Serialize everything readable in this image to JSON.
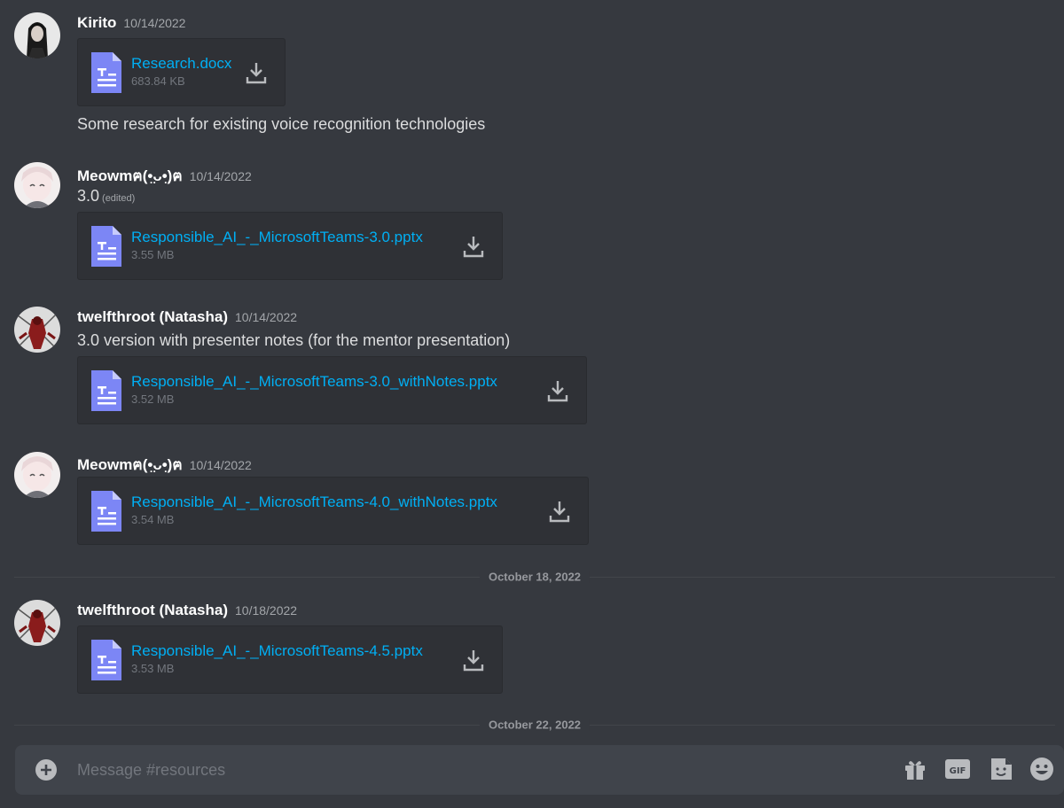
{
  "messages": [
    {
      "username": "Kirito",
      "timestamp": "10/14/2022",
      "file": {
        "name": "Research.docx",
        "size": "683.84 KB"
      },
      "text": "Some research for existing voice recognition technologies"
    },
    {
      "username": "Meowmฅ(•̤ᴗ•̤)ฅ",
      "timestamp": "10/14/2022",
      "text": "3.0",
      "edited": "(edited)",
      "file": {
        "name": "Responsible_AI_-_MicrosoftTeams-3.0.pptx",
        "size": "3.55 MB"
      }
    },
    {
      "username": "twelfthroot (Natasha)",
      "timestamp": "10/14/2022",
      "text": "3.0 version with presenter notes (for the mentor presentation)",
      "file": {
        "name": "Responsible_AI_-_MicrosoftTeams-3.0_withNotes.pptx",
        "size": "3.52 MB"
      }
    },
    {
      "username": "Meowmฅ(•̤ᴗ•̤)ฅ",
      "timestamp": "10/14/2022",
      "file": {
        "name": "Responsible_AI_-_MicrosoftTeams-4.0_withNotes.pptx",
        "size": "3.54 MB"
      }
    },
    {
      "username": "twelfthroot (Natasha)",
      "timestamp": "10/18/2022",
      "file": {
        "name": "Responsible_AI_-_MicrosoftTeams-4.5.pptx",
        "size": "3.53 MB"
      }
    }
  ],
  "dividers": [
    "October 18, 2022",
    "October 22, 2022"
  ],
  "composer": {
    "placeholder": "Message #resources",
    "tools": [
      "gift-icon",
      "gif-icon",
      "sticker-icon",
      "emoji-icon"
    ]
  },
  "icons": {
    "file": "document-icon",
    "download": "download-icon",
    "add": "plus-circle-icon"
  },
  "colors": {
    "background": "#36393f",
    "link": "#00aff4",
    "attachment_bg": "#2f3136",
    "composer_bg": "#40444b"
  }
}
